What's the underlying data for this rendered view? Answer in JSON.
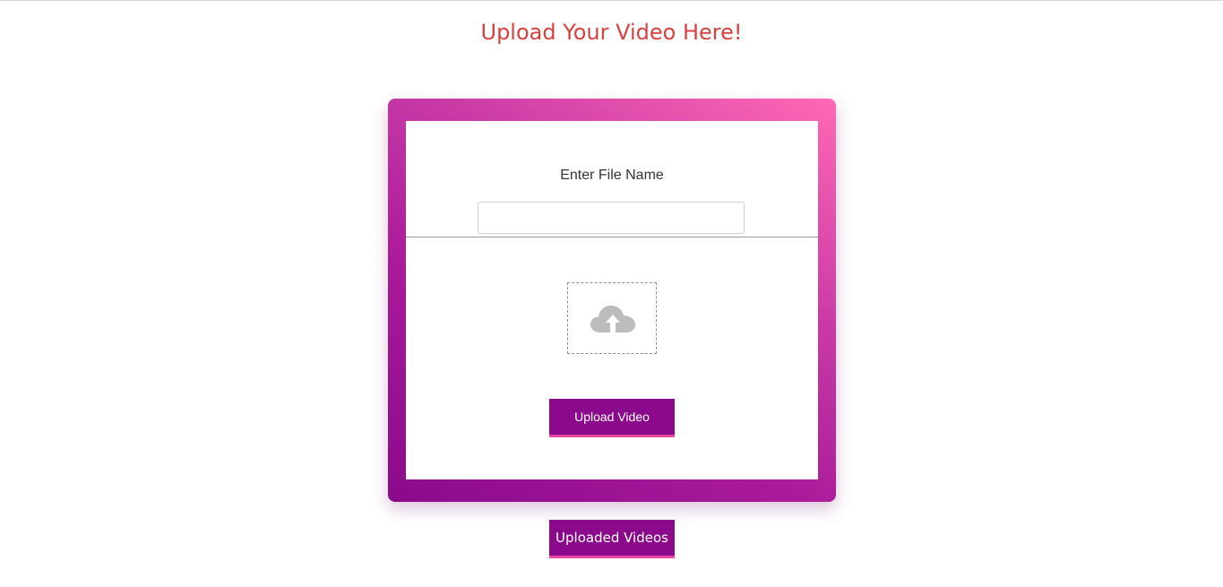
{
  "page": {
    "title": "Upload Your Video Here!"
  },
  "form": {
    "file_name_label": "Enter File Name",
    "file_name_value": "",
    "file_name_placeholder": "",
    "drop_zone_icon": "cloud-upload-icon",
    "upload_button_label": "Upload Video"
  },
  "footer": {
    "uploaded_videos_label": "Uploaded Videos"
  },
  "colors": {
    "title": "#d9413f",
    "button": "#8b0a8c",
    "button_underline": "#e8489f",
    "frame_gradient_start": "#8a0a8c",
    "frame_gradient_end": "#ff69b4",
    "icon": "#bcbcbc"
  }
}
